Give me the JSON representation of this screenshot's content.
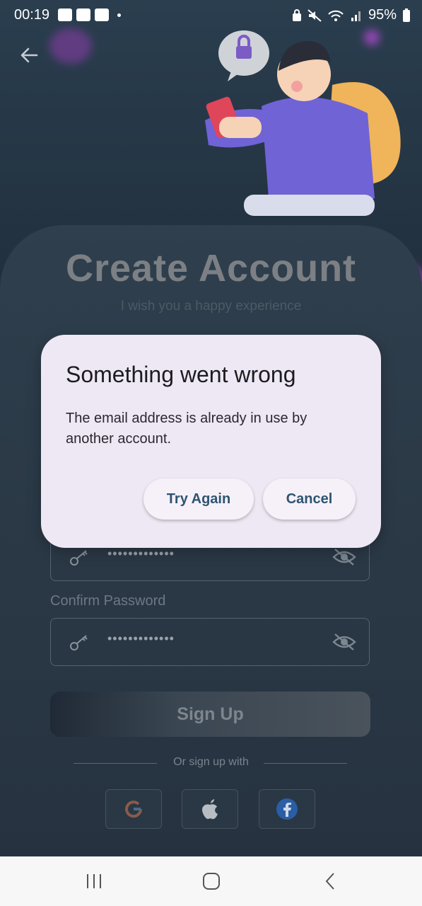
{
  "status_bar": {
    "time": "00:19",
    "battery": "95%"
  },
  "screen": {
    "title": "Create Account",
    "subtitle": "I wish you a happy experience",
    "password": {
      "masked_value": "•••••••••••••"
    },
    "confirm_password": {
      "label": "Confirm Password",
      "masked_value": "•••••••••••••"
    },
    "signup_label": "Sign Up",
    "divider_text": "Or sign up with"
  },
  "dialog": {
    "title": "Something went wrong",
    "message": "The email address is already in use by another account.",
    "try_again": "Try Again",
    "cancel": "Cancel"
  },
  "colors": {
    "accent": "#2e5470",
    "dialog_bg": "#eee8f4"
  }
}
